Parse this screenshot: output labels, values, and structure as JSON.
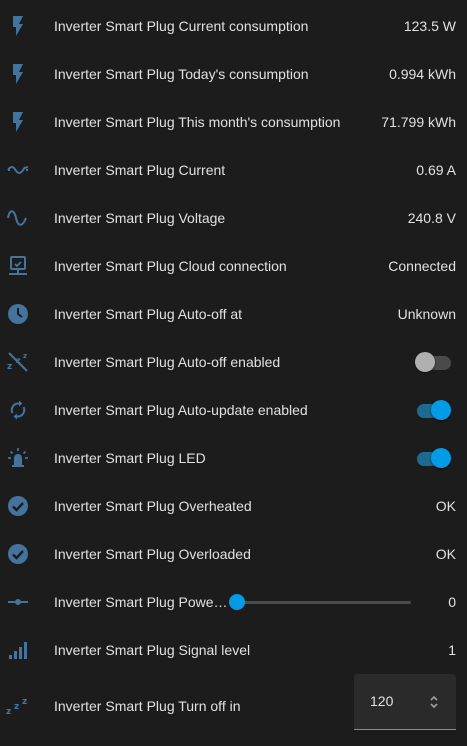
{
  "colors": {
    "icon": "#44739e",
    "accent": "#039be5",
    "background": "#1c1c1c",
    "text": "#e1e1e1"
  },
  "entities": [
    {
      "icon": "flash-icon",
      "label": "Inverter Smart Plug Current consumption",
      "value": "123.5 W"
    },
    {
      "icon": "flash-icon",
      "label": "Inverter Smart Plug Today's consumption",
      "value": "0.994 kWh"
    },
    {
      "icon": "flash-icon",
      "label": "Inverter Smart Plug This month's consumption",
      "value": "71.799 kWh"
    },
    {
      "icon": "current-ac-icon",
      "label": "Inverter Smart Plug Current",
      "value": "0.69 A"
    },
    {
      "icon": "sine-wave-icon",
      "label": "Inverter Smart Plug Voltage",
      "value": "240.8 V"
    },
    {
      "icon": "cloud-connection-icon",
      "label": "Inverter Smart Plug Cloud connection",
      "value": "Connected"
    },
    {
      "icon": "clock-icon",
      "label": "Inverter Smart Plug Auto-off at",
      "value": "Unknown"
    },
    {
      "icon": "sleep-off-icon",
      "label": "Inverter Smart Plug Auto-off enabled",
      "toggle": "off"
    },
    {
      "icon": "autorenew-icon",
      "label": "Inverter Smart Plug Auto-update enabled",
      "toggle": "on"
    },
    {
      "icon": "led-icon",
      "label": "Inverter Smart Plug LED",
      "toggle": "on"
    },
    {
      "icon": "check-circle-icon",
      "label": "Inverter Smart Plug Overheated",
      "value": "OK"
    },
    {
      "icon": "check-circle-icon",
      "label": "Inverter Smart Plug Overloaded",
      "value": "OK"
    },
    {
      "icon": "ray-vertex-icon",
      "label": "Inverter Smart Plug Power…",
      "slider_value": 0,
      "value": "0"
    },
    {
      "icon": "signal-icon",
      "label": "Inverter Smart Plug Signal level",
      "value": "1"
    },
    {
      "icon": "sleep-icon",
      "label": "Inverter Smart Plug Turn off in",
      "number": "120"
    }
  ]
}
